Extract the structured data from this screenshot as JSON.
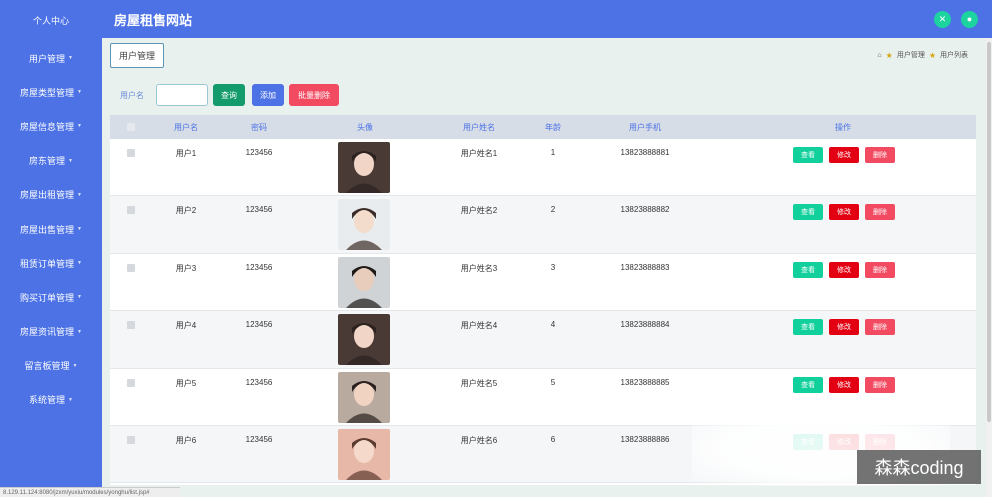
{
  "app": {
    "title": "房屋租售网站"
  },
  "sidebar": {
    "items": [
      {
        "label": "个人中心"
      },
      {
        "label": "用户管理"
      },
      {
        "label": "房屋类型管理"
      },
      {
        "label": "房屋信息管理"
      },
      {
        "label": "房东管理"
      },
      {
        "label": "房屋出租管理"
      },
      {
        "label": "房屋出售管理"
      },
      {
        "label": "租赁订单管理"
      },
      {
        "label": "购买订单管理"
      },
      {
        "label": "房屋资讯管理"
      },
      {
        "label": "留言板管理"
      },
      {
        "label": "系统管理"
      }
    ]
  },
  "subbar": {
    "tag": "用户管理",
    "breadcrumb": [
      "用户管理",
      "用户列表"
    ]
  },
  "search": {
    "label": "用户名",
    "value": "",
    "query_btn": "查询",
    "add_btn": "添加",
    "batch_del_btn": "批量删除"
  },
  "table": {
    "columns": [
      "用户名",
      "密码",
      "头像",
      "用户姓名",
      "年龄",
      "用户手机",
      "操作"
    ],
    "rows": [
      {
        "username": "用户1",
        "password": "123456",
        "name": "用户姓名1",
        "age": "1",
        "phone": "13823888881"
      },
      {
        "username": "用户2",
        "password": "123456",
        "name": "用户姓名2",
        "age": "2",
        "phone": "13823888882"
      },
      {
        "username": "用户3",
        "password": "123456",
        "name": "用户姓名3",
        "age": "3",
        "phone": "13823888883"
      },
      {
        "username": "用户4",
        "password": "123456",
        "name": "用户姓名4",
        "age": "4",
        "phone": "13823888884"
      },
      {
        "username": "用户5",
        "password": "123456",
        "name": "用户姓名5",
        "age": "5",
        "phone": "13823888885"
      },
      {
        "username": "用户6",
        "password": "123456",
        "name": "用户姓名6",
        "age": "6",
        "phone": "13823888886"
      }
    ],
    "actions": {
      "view": "查看",
      "edit": "修改",
      "delete": "删除"
    }
  },
  "status_url": "8.129.11.124:8080/jzxm/yuxiu/modules/yonghu/list.jsp#",
  "watermark": "森森coding",
  "colors": {
    "primary": "#4c72e6",
    "accent": "#12d09c",
    "danger": "#e20012",
    "pink": "#f24a61",
    "query": "#149b6b"
  }
}
